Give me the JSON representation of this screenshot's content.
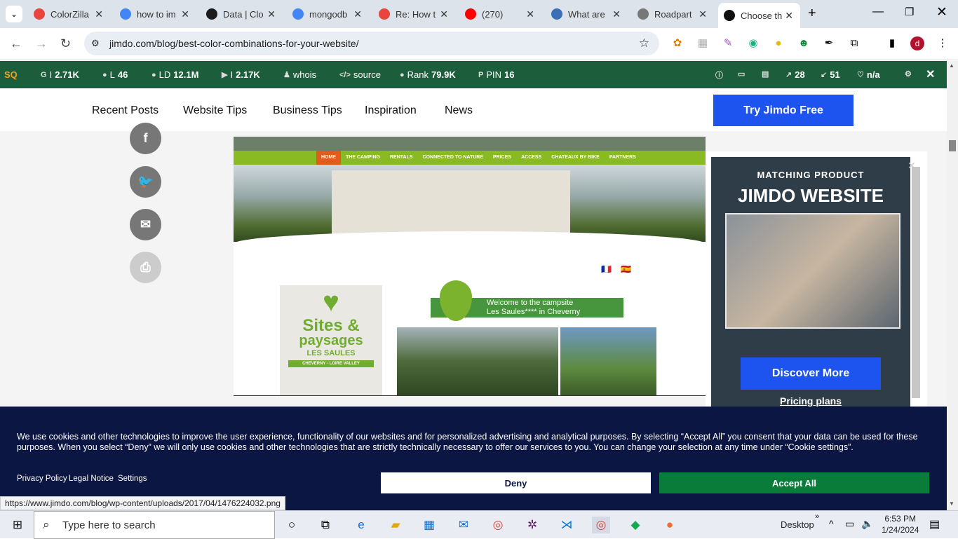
{
  "browser": {
    "tabs": [
      {
        "title": "ColorZilla",
        "color": "#e8453c"
      },
      {
        "title": "how to im",
        "color": "#4285f4"
      },
      {
        "title": "Data | Clo",
        "color": "#1b1b1b"
      },
      {
        "title": "mongodb",
        "color": "#4285f4"
      },
      {
        "title": "Re: How t",
        "color": "#e8453c"
      },
      {
        "title": "(270)",
        "color": "#ff0000"
      },
      {
        "title": "What are",
        "color": "#3b6fb6"
      },
      {
        "title": "Roadpart",
        "color": "#777777"
      },
      {
        "title": "Choose th",
        "color": "#111111"
      }
    ],
    "url": "jimdo.com/blog/best-color-combinations-for-your-website/",
    "profile_initial": "d"
  },
  "seo_bar": {
    "items": [
      {
        "icon": "G",
        "label": "I",
        "value": "2.71K"
      },
      {
        "icon": "●",
        "label": "L",
        "value": "46"
      },
      {
        "icon": "●",
        "label": "LD",
        "value": "12.1M"
      },
      {
        "icon": "▶",
        "label": "I",
        "value": "2.17K"
      },
      {
        "icon": "♟",
        "label": "whois",
        "value": ""
      },
      {
        "icon": "</>",
        "label": "source",
        "value": ""
      },
      {
        "icon": "●",
        "label": "Rank",
        "value": "79.9K"
      },
      {
        "icon": "P",
        "label": "PIN",
        "value": "16"
      }
    ],
    "right": [
      "28",
      "51",
      "n/a"
    ]
  },
  "site_nav": {
    "links": [
      "Recent Posts",
      "Website Tips",
      "Business Tips",
      "Inspiration",
      "News"
    ],
    "cta": "Try Jimdo Free"
  },
  "screenshot": {
    "nav": [
      "HOME",
      "THE CAMPING",
      "RENTALS",
      "CONNECTED TO NATURE",
      "PRICES",
      "ACCESS",
      "CHATEAUX BY BIKE",
      "PARTNERS"
    ],
    "logo_line1": "Sites &",
    "logo_line2": "paysages",
    "logo_line3": "LES SAULES",
    "logo_line4": "CHEVERNY - LOIRE VALLEY",
    "welcome1": "Welcome to the campsite",
    "welcome2": "Les Saules**** in Cheverny"
  },
  "ad": {
    "label": "MATCHING PRODUCT",
    "title": "JIMDO WEBSITE",
    "button": "Discover More",
    "link": "Pricing plans"
  },
  "cookie": {
    "text": "We use cookies and other technologies to improve the user experience, functionality of our websites and for personalized advertising and analytical purposes. By selecting “Accept All” you consent that your data can be used for these purposes. When you select “Deny” we will only use cookies and other technologies that are strictly technically necessary to offer our services to you. You can change your selection at any time under “Cookie settings”.",
    "links": [
      "Privacy Policy",
      "Legal Notice",
      "Settings"
    ],
    "deny": "Deny",
    "accept": "Accept All"
  },
  "status_url": "https://www.jimdo.com/blog/wp-content/uploads/2017/04/1476224032.png",
  "taskbar": {
    "search_placeholder": "Type here to search",
    "desktop": "Desktop",
    "time": "6:53 PM",
    "date": "1/24/2024"
  }
}
